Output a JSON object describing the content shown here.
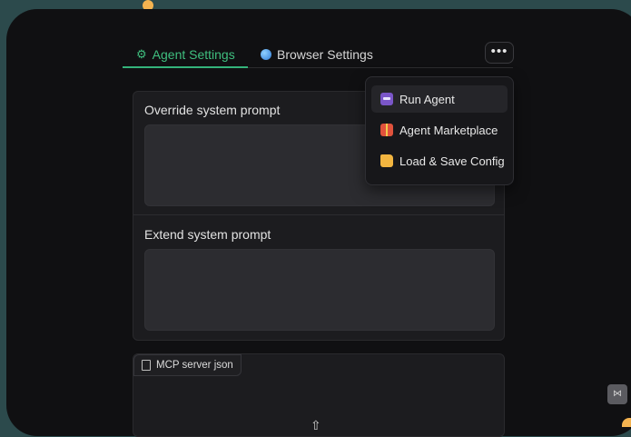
{
  "tabs": [
    {
      "label": "Agent Settings",
      "icon": "gear-icon",
      "active": true
    },
    {
      "label": "Browser Settings",
      "icon": "globe-icon",
      "active": false
    }
  ],
  "more_menu": {
    "button_label": "•••",
    "items": [
      {
        "label": "Run Agent",
        "icon": "robot-icon"
      },
      {
        "label": "Agent Marketplace",
        "icon": "gift-icon"
      },
      {
        "label": "Load & Save Config",
        "icon": "folder-icon"
      }
    ]
  },
  "prompts": {
    "override_label": "Override system prompt",
    "override_value": "",
    "extend_label": "Extend system prompt",
    "extend_value": ""
  },
  "mcp": {
    "label": "MCP server json"
  },
  "colors": {
    "accent": "#34b37a",
    "background": "#101012",
    "panel": "#1c1c1f",
    "outer": "#2c4a4c"
  }
}
